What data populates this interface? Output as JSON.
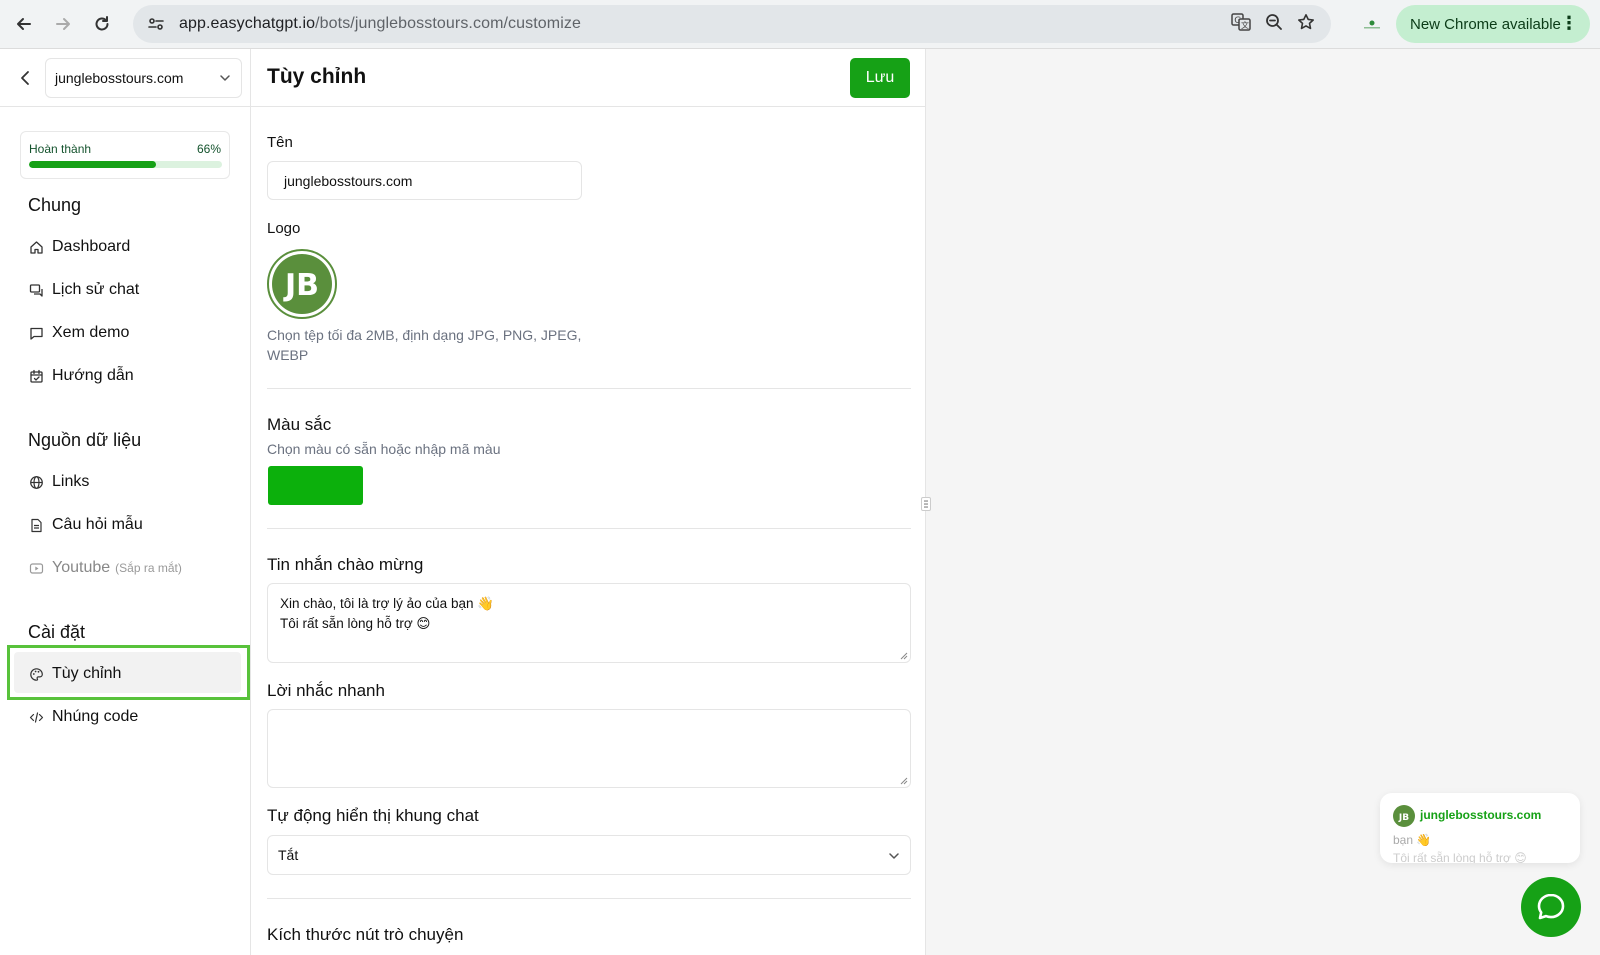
{
  "browser": {
    "url_host": "app.easychatgpt.io",
    "url_path": "/bots/junglebosstours.com/customize",
    "update_label": "New Chrome available",
    "icons": [
      "back-icon",
      "forward-icon",
      "reload-icon",
      "site-info-icon",
      "translate-icon",
      "zoom-icon",
      "bookmark-star-icon",
      "kebab-menu-icon"
    ]
  },
  "sidebar": {
    "bot_name": "junglebosstours.com",
    "progress": {
      "label": "Hoàn thành",
      "percent_text": "66%",
      "value": 0.66
    },
    "sections": {
      "general": "Chung",
      "data_sources": "Nguồn dữ liệu",
      "settings": "Cài đặt"
    },
    "items": {
      "dashboard": "Dashboard",
      "chat_history": "Lịch sử chat",
      "demo": "Xem demo",
      "guide": "Hướng dẫn",
      "links": "Links",
      "sample_questions": "Câu hỏi mẫu",
      "youtube": "Youtube",
      "youtube_note": "(Sắp ra mắt)",
      "customize": "Tùy chỉnh",
      "embed_code": "Nhúng code"
    }
  },
  "main": {
    "title": "Tùy chỉnh",
    "save_label": "Lưu",
    "name_label": "Tên",
    "name_value": "junglebosstours.com",
    "logo_label": "Logo",
    "logo_hint_line1": "Chọn tệp tối đa 2MB, định dạng JPG, PNG, JPEG,",
    "logo_hint_line2": "WEBP",
    "color_label": "Màu sắc",
    "color_hint": "Chọn màu có sẵn hoặc nhập mã màu",
    "color_value": "#0cb00c",
    "welcome_label": "Tin nhắn chào mừng",
    "welcome_line1": "Xin chào, tôi là trợ lý ảo của bạn 👋",
    "welcome_line2": "Tôi rất sẵn lòng hỗ trợ 😊",
    "quick_prompts_label": "Lời nhắc nhanh",
    "auto_show_label": "Tự động hiển thị khung chat",
    "auto_show_value": "Tắt",
    "button_size_label": "Kích thước nút trò chuyện"
  },
  "preview": {
    "bot_name": "junglebosstours.com",
    "message_fragment": "bạn 👋",
    "message_fragment2": "Tôi rất sẵn lòng hỗ trợ 😊",
    "logo_text": "JB"
  },
  "colors": {
    "accent": "#16a116",
    "highlight_border": "#58c23b",
    "chrome_update_bg": "#c4eed0",
    "logo_green": "#5a8f3c"
  }
}
